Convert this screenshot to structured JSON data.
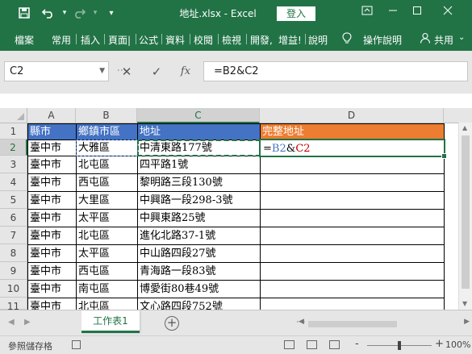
{
  "title_bar": {
    "icons": [
      "save-icon",
      "undo-icon",
      "redo-icon",
      "customize-quick-access-icon"
    ],
    "file_title": "地址.xlsx - Excel",
    "login_label": "登入",
    "window_controls": [
      "ribbon-options-icon",
      "minimize-icon",
      "maximize-icon",
      "close-icon"
    ]
  },
  "ribbon": {
    "tabs": [
      "檔案",
      "常用",
      "插入",
      "頁面|",
      "公式",
      "資料",
      "校閱",
      "檢視",
      "開發,",
      "增益!",
      "說明"
    ],
    "tell_me_label": "操作說明",
    "share_label": "共用"
  },
  "formula_bar": {
    "name_box": "C2",
    "cancel_symbol": "✕",
    "enter_symbol": "✓",
    "fx_symbol": "fx",
    "formula": "=B2&C2"
  },
  "sheet": {
    "columns": [
      "A",
      "B",
      "C",
      "D"
    ],
    "rows": [
      "1",
      "2",
      "3",
      "4",
      "5",
      "6",
      "7",
      "8",
      "9",
      "10",
      "11"
    ],
    "header_row": [
      "縣市",
      "鄉鎮市區",
      "地址",
      "完整地址"
    ],
    "data": [
      [
        "臺中市",
        "大雅區",
        "中清東路177號"
      ],
      [
        "臺中市",
        "北屯區",
        "四平路1號"
      ],
      [
        "臺中市",
        "西屯區",
        "黎明路三段130號"
      ],
      [
        "臺中市",
        "大里區",
        "中興路一段298-3號"
      ],
      [
        "臺中市",
        "太平區",
        "中興東路25號"
      ],
      [
        "臺中市",
        "北屯區",
        "進化北路37-1號"
      ],
      [
        "臺中市",
        "太平區",
        "中山路四段27號"
      ],
      [
        "臺中市",
        "西屯區",
        "青海路一段83號"
      ],
      [
        "臺中市",
        "南屯區",
        "博愛街80巷49號"
      ],
      [
        "臺中市",
        "北屯區",
        "文心路四段752號"
      ]
    ],
    "editing": {
      "eq": "=",
      "ref1": "B2",
      "amp": "&",
      "ref2": "C2"
    },
    "colors": {
      "header_blue": "#4472c4",
      "header_orange": "#ed7d31",
      "accent": "#217346"
    }
  },
  "sheet_tabs": {
    "active": "工作表1",
    "add_symbol": "+"
  },
  "status_bar": {
    "text": "參照儲存格",
    "zoom_minus": "-",
    "zoom_plus": "+",
    "zoom": "100%"
  }
}
